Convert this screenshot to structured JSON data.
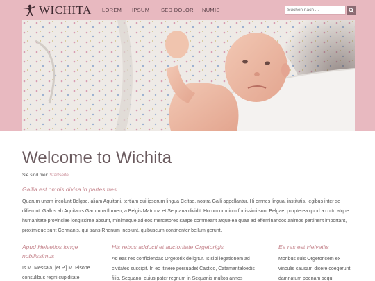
{
  "header": {
    "brand": "WICHITA",
    "nav": [
      "LOREM",
      "IPSUM",
      "SED DOLOR",
      "NUMIS"
    ],
    "search_placeholder": "Suchen nach ...",
    "colors": {
      "band": "#e8b9c0",
      "accent": "#c6878f"
    }
  },
  "hero": {
    "image": "baby-photo"
  },
  "main": {
    "title": "Welcome to Wichita",
    "breadcrumb_prefix": "Sie sind hier:",
    "breadcrumb_link": "Startseite",
    "intro_heading": "Gallia est omnis divisa in partes tres",
    "intro_text": "Quarum unam incolunt Belgae, aliam Aquitani, tertiam qui ipsorum lingua Celtae, nostra Galli appellantur. Hi omnes lingua, institutis, legibus inter se differunt. Gallos ab Aquitanis Garumna flumen, a Belgis Matrona et Sequana dividit. Horum omnium fortissimi sunt Belgae, propterea quod a cultu atque humanitate provinciae longissime absunt, minimeque ad eos mercatores saepe commeant atque ea quae ad effeminandos animos pertinent important, proximique sunt Germanis, qui trans Rhenum incolunt, quibuscum continenter bellum gerunt."
  },
  "columns": [
    {
      "heading": "Apud Helvetios longe nobilissimus",
      "text": "Is M. Messala, [et P.] M. Pisone consulibus regni cupiditate"
    },
    {
      "heading": "His rebus adducti et auctoritate Orgetorigis",
      "text": "Ad eas res conficiendas Orgetorix deligitur. Is sibi legationem ad civitates suscipit. In eo itinere persuadet Castico, Catamantaloedis filio, Sequano, cuius pater regnum in Sequanis multos annos obtinuerat et a"
    },
    {
      "heading": "Ea res est Helvetiis",
      "text": "Moribus suis Orgetoricem ex vinculis causam dicere coegerunt; damnatum poenam sequi"
    }
  ]
}
